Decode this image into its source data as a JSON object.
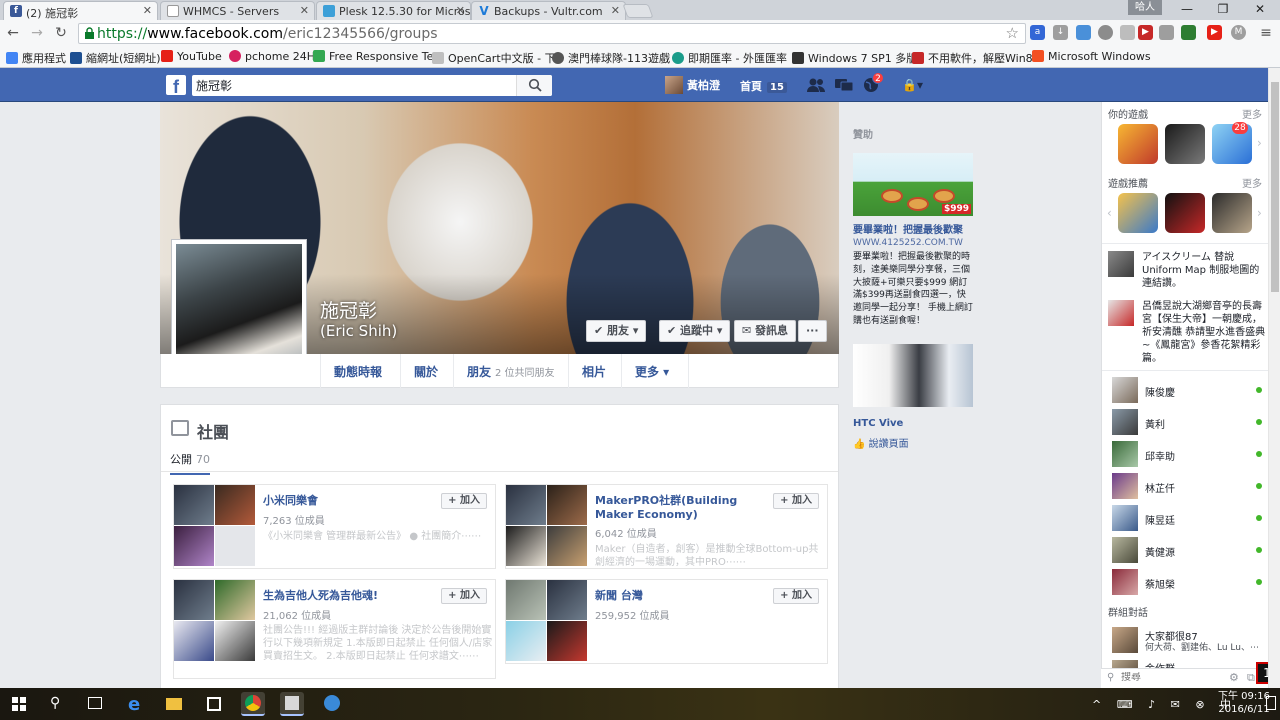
{
  "browser": {
    "tabs": [
      {
        "title": "(2) 施冠彰",
        "favicon": "f",
        "color": "#3b5998"
      },
      {
        "title": "WHMCS - Servers",
        "favicon": "",
        "color": "#9aa0a6"
      },
      {
        "title": "Plesk 12.5.30 for Microsc",
        "favicon": "",
        "color": "#3da0d8"
      },
      {
        "title": "Backups - Vultr.com",
        "favicon": "V",
        "color": "#1d7bd8"
      }
    ],
    "profile_name": "哈人",
    "url_proto": "https://",
    "url_host": "www.facebook.com",
    "url_path": "/eric12345566/groups"
  },
  "bookmarks": [
    {
      "label": "應用程式",
      "color": "#4285f4"
    },
    {
      "label": "縮網址(短網址)",
      "color": "#1d4f91"
    },
    {
      "label": "YouTube",
      "color": "#e62117"
    },
    {
      "label": "pchome 24H",
      "color": "#d6215f"
    },
    {
      "label": "Free Responsive Ten",
      "color": "#33a852"
    },
    {
      "label": "OpenCart中文版 - 下",
      "color": "#bfbfbf"
    },
    {
      "label": "澳門棒球隊-113遊戲",
      "color": "#555555"
    },
    {
      "label": "即期匯率 - 外匯匯率",
      "color": "#1a9c8a"
    },
    {
      "label": "Windows 7 SP1 多版",
      "color": "#333333"
    },
    {
      "label": "不用軟件，解壓Win8",
      "color": "#c62828"
    },
    {
      "label": "Microsoft Windows",
      "color": "#f25022"
    }
  ],
  "fb": {
    "logo": "f",
    "search_value": "施冠彰",
    "user_name": "黃柏澄",
    "home_label": "首頁",
    "home_count": "15",
    "notif_count": "2"
  },
  "profile": {
    "name": "施冠彰",
    "alt_name": "(Eric Shih)",
    "btn_friends": "✔ 朋友 ▾",
    "btn_following": "✔ 追蹤中 ▾",
    "btn_message": "✉ 發訊息",
    "btn_more": "···",
    "nav": {
      "timeline": "動態時報",
      "about": "關於",
      "friends": "朋友",
      "friends_sub": "2 位共同朋友",
      "photos": "相片",
      "more": "更多 ▾"
    }
  },
  "groups": {
    "title": "社團",
    "tab_label": "公開",
    "tab_count": "70",
    "join_label": "+ 加入",
    "items": [
      {
        "name": "小米同樂會",
        "members": "7,263 位成員",
        "desc": "《小米同樂會 管理群最新公告》 ● 社團簡介⋯⋯"
      },
      {
        "name": "MakerPRO社群(Building Maker Economy)",
        "members": "6,042 位成員",
        "desc": "Maker（自造者，創客）是推動全球Bottom-up共創經濟的一場運動，其中PRO⋯⋯"
      },
      {
        "name": "生為吉他人死為吉他魂!",
        "members": "21,062 位成員",
        "desc": "社團公告!!! 經過版主群討論後 決定於公告後開始實行以下幾項新規定 1.本版即日起禁止 任何個人/店家買賣招生文。 2.本版即日起禁止 任何求譜文⋯⋯"
      },
      {
        "name": "新聞 台灣",
        "members": "259,952 位成員",
        "desc": ""
      }
    ]
  },
  "ads": {
    "title": "贊助",
    "ad1_price": "$999",
    "ad1_title": "要畢業啦！把握最後歡聚",
    "ad1_url": "WWW.4125252.COM.TW",
    "ad1_desc": "要畢業啦！把握最後歡聚的時刻，達美樂同學分享餐，三個大披薩+可樂只要$999 網訂滿$399再送副食四選一，快邀同學一起分享！ 手機上網訂購也有送副食喔！",
    "ad2_title": "HTC Vive",
    "ad2_like": "說讚頁面"
  },
  "sidebar": {
    "games_title": "你的遊戲",
    "more": "更多",
    "games_badge": "28",
    "rec_title": "遊戲推薦",
    "ticker": [
      {
        "text": "アイスクリーム 替說 Uniform Map 制服地圖的連結讚。"
      },
      {
        "text": "呂僑昱說大湖鄉音亭的長壽宮【保生大帝】一朝慶成，祈安清醮 恭請聖水進香盛典~《鳳龍宮》參香花絮精彩篇。"
      }
    ],
    "contacts": [
      {
        "name": "陳俊慶"
      },
      {
        "name": "黃利"
      },
      {
        "name": "邱幸助"
      },
      {
        "name": "林芷仟"
      },
      {
        "name": "陳昱廷"
      },
      {
        "name": "黃健源"
      },
      {
        "name": "蔡旭榮"
      }
    ],
    "group_chat_title": "群組對話",
    "group_chat": {
      "title": "大家都很87",
      "members": "何大荷、劉建佑、Lu Lu、⋯"
    },
    "group_chat2": "金作群",
    "search_placeholder": "搜尋"
  },
  "taskbar": {
    "time": "下午 09:16",
    "date": "2016/6/11"
  }
}
